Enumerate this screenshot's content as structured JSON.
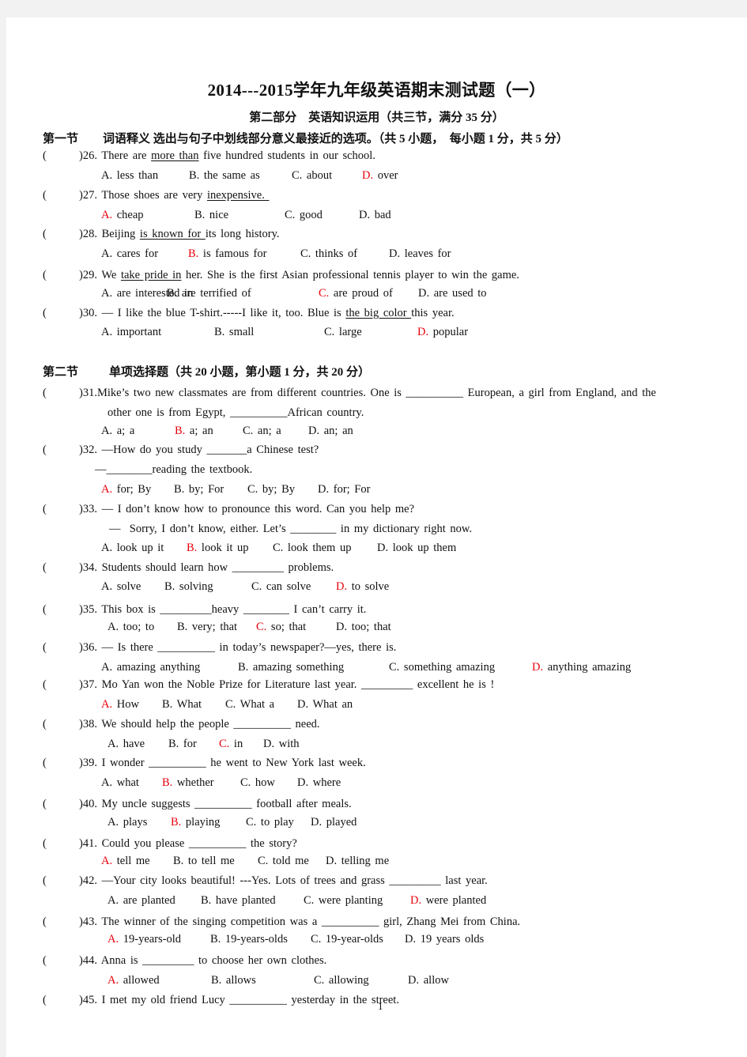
{
  "title": "2014---2015学年九年级英语期末测试题（一）",
  "subtitle": "第二部分    英语知识运用（共三节，满分 35 分）",
  "section1": {
    "label": "第一节",
    "heading": "词语释义 选出与句子中划线部分意义最接近的选项。（共 5 小题，  每小题 1 分，共 5 分）",
    "questions": [
      {
        "num": ")26.",
        "pre": "There are ",
        "underlined": "more than",
        "post": " five hundred students in our school.",
        "options": [
          {
            "letter": "A.",
            "text": " less than",
            "correct": false
          },
          {
            "letter": "B.",
            "text": " the same as",
            "correct": false
          },
          {
            "letter": "C.",
            "text": " about",
            "correct": false
          },
          {
            "letter": "D.",
            "text": " over",
            "correct": true
          }
        ]
      },
      {
        "num": ")27.",
        "pre": "Those shoes are very ",
        "underlined": "inexpensive. ",
        "post": "",
        "options": [
          {
            "letter": "A.",
            "text": " cheap",
            "correct": true
          },
          {
            "letter": "B.",
            "text": " nice",
            "correct": false
          },
          {
            "letter": "C.",
            "text": " good",
            "correct": false
          },
          {
            "letter": "D.",
            "text": " bad",
            "correct": false
          }
        ]
      },
      {
        "num": ")28.",
        "pre": "Beijing ",
        "underlined": "is known for ",
        "post": "its long history.",
        "options": [
          {
            "letter": "A.",
            "text": " cares for",
            "correct": false
          },
          {
            "letter": "B.",
            "text": " is famous for",
            "correct": true
          },
          {
            "letter": "C.",
            "text": " thinks of",
            "correct": false
          },
          {
            "letter": "D.",
            "text": " leaves for",
            "correct": false
          }
        ]
      },
      {
        "num": ")29.",
        "pre": "We ",
        "underlined": "take pride in",
        "post": " her. She is the first Asian professional tennis player to win the game.",
        "options": [
          {
            "letter": "A.",
            "text": " are interested in",
            "correct": false
          },
          {
            "letter": "B.",
            "text": " are terrified of",
            "correct": false
          },
          {
            "letter": "C.",
            "text": " are proud of",
            "correct": true
          },
          {
            "letter": "D.",
            "text": " are used to",
            "correct": false
          }
        ]
      },
      {
        "num": ")30.",
        "pre": "— I like the blue T-shirt.-----I like it, too. Blue is ",
        "underlined": "the big color ",
        "post": "this year.",
        "options": [
          {
            "letter": "A.",
            "text": " important",
            "correct": false
          },
          {
            "letter": "B.",
            "text": " small",
            "correct": false
          },
          {
            "letter": "C.",
            "text": " large",
            "correct": false
          },
          {
            "letter": "D.",
            "text": " popular",
            "correct": true
          }
        ]
      }
    ]
  },
  "section2": {
    "label": "第二节",
    "heading": "单项选择题（共 20 小题，第小题 1 分，共 20 分）",
    "questions": [
      {
        "num": ")31.",
        "lines": [
          "Mike’s two new classmates are from different countries. One is __________ European, a girl from England, and the",
          "other one is from Egypt, __________African country."
        ],
        "options": [
          {
            "letter": "A.",
            "text": " a; a",
            "correct": false
          },
          {
            "letter": "B.",
            "text": " a; an",
            "correct": true
          },
          {
            "letter": "C.",
            "text": " an; a",
            "correct": false
          },
          {
            "letter": "D.",
            "text": " an; an",
            "correct": false
          }
        ]
      },
      {
        "num": ")32.",
        "lines": [
          "—How do you study _______a Chinese test?",
          "—________reading the textbook."
        ],
        "options": [
          {
            "letter": "A.",
            "text": " for; By",
            "correct": true
          },
          {
            "letter": "B.",
            "text": " by; For",
            "correct": false
          },
          {
            "letter": "C.",
            "text": " by; By",
            "correct": false
          },
          {
            "letter": "D.",
            "text": " for; For",
            "correct": false
          }
        ]
      },
      {
        "num": ")33.",
        "lines": [
          "— I don’t know how to pronounce this word. Can you help me?",
          "—  Sorry, I don’t know, either. Let’s ________ in my dictionary right now."
        ],
        "options": [
          {
            "letter": "A.",
            "text": " look up it",
            "correct": false
          },
          {
            "letter": "B.",
            "text": " look it up",
            "correct": true
          },
          {
            "letter": "C.",
            "text": " look them up",
            "correct": false
          },
          {
            "letter": "D.",
            "text": " look up them",
            "correct": false
          }
        ]
      },
      {
        "num": ")34.",
        "lines": [
          "Students should learn how _________ problems."
        ],
        "options": [
          {
            "letter": "A.",
            "text": " solve",
            "correct": false
          },
          {
            "letter": "B.",
            "text": " solving",
            "correct": false
          },
          {
            "letter": "C.",
            "text": " can solve",
            "correct": false
          },
          {
            "letter": "D.",
            "text": " to solve",
            "correct": true
          }
        ]
      },
      {
        "num": ")35.",
        "lines": [
          "This box is _________heavy ________ I can’t carry it."
        ],
        "options": [
          {
            "letter": "A.",
            "text": " too; to",
            "correct": false
          },
          {
            "letter": "B.",
            "text": " very; that",
            "correct": false
          },
          {
            "letter": "C.",
            "text": " so; that",
            "correct": true
          },
          {
            "letter": "D.",
            "text": " too; that",
            "correct": false
          }
        ]
      },
      {
        "num": ")36.",
        "lines": [
          "— Is there __________ in today’s newspaper?—yes, there is."
        ],
        "options": [
          {
            "letter": "A.",
            "text": " amazing anything",
            "correct": false
          },
          {
            "letter": "B.",
            "text": " amazing something",
            "correct": false
          },
          {
            "letter": "C.",
            "text": " something amazing",
            "correct": false
          },
          {
            "letter": "D.",
            "text": " anything amazing",
            "correct": true
          }
        ]
      },
      {
        "num": ")37.",
        "lines": [
          "Mo Yan won the Noble Prize for Literature last year. _________ excellent he is !"
        ],
        "options": [
          {
            "letter": "A.",
            "text": " How",
            "correct": true
          },
          {
            "letter": "B.",
            "text": " What",
            "correct": false
          },
          {
            "letter": "C.",
            "text": " What a",
            "correct": false
          },
          {
            "letter": "D.",
            "text": " What an",
            "correct": false
          }
        ]
      },
      {
        "num": ")38.",
        "lines": [
          "We should help the people __________ need."
        ],
        "options": [
          {
            "letter": "A.",
            "text": " have",
            "correct": false
          },
          {
            "letter": "B.",
            "text": " for",
            "correct": false
          },
          {
            "letter": "C.",
            "text": " in",
            "correct": true
          },
          {
            "letter": "D.",
            "text": " with",
            "correct": false
          }
        ]
      },
      {
        "num": ")39.",
        "lines": [
          "I wonder __________ he went to New York last week."
        ],
        "options": [
          {
            "letter": "A.",
            "text": " what",
            "correct": false
          },
          {
            "letter": "B.",
            "text": " whether",
            "correct": true
          },
          {
            "letter": "C.",
            "text": " how",
            "correct": false
          },
          {
            "letter": "D.",
            "text": " where",
            "correct": false
          }
        ]
      },
      {
        "num": ")40.",
        "lines": [
          "My uncle suggests __________ football after meals."
        ],
        "options": [
          {
            "letter": "A.",
            "text": " plays",
            "correct": false
          },
          {
            "letter": "B.",
            "text": " playing",
            "correct": true
          },
          {
            "letter": "C.",
            "text": " to play",
            "correct": false
          },
          {
            "letter": "D.",
            "text": " played",
            "correct": false
          }
        ]
      },
      {
        "num": ")41.",
        "lines": [
          "Could you please __________ the story?"
        ],
        "options": [
          {
            "letter": "A.",
            "text": " tell me",
            "correct": true
          },
          {
            "letter": "B.",
            "text": " to tell me",
            "correct": false
          },
          {
            "letter": "C.",
            "text": " told me",
            "correct": false
          },
          {
            "letter": "D.",
            "text": " telling me",
            "correct": false
          }
        ]
      },
      {
        "num": ")42.",
        "lines": [
          "—Your city looks beautiful! ---Yes. Lots of trees and grass _________ last year."
        ],
        "options": [
          {
            "letter": "A.",
            "text": " are planted",
            "correct": false
          },
          {
            "letter": "B.",
            "text": " have planted",
            "correct": false
          },
          {
            "letter": "C.",
            "text": " were planting",
            "correct": false
          },
          {
            "letter": "D.",
            "text": " were planted",
            "correct": true
          }
        ]
      },
      {
        "num": ")43.",
        "lines": [
          "The winner of the singing competition was a __________ girl, Zhang Mei from China."
        ],
        "options": [
          {
            "letter": "A.",
            "text": " 19-years-old",
            "correct": true
          },
          {
            "letter": "B.",
            "text": " 19-years-olds",
            "correct": false
          },
          {
            "letter": "C.",
            "text": " 19-year-olds",
            "correct": false
          },
          {
            "letter": "D.",
            "text": " 19 years olds",
            "correct": false
          }
        ]
      },
      {
        "num": ")44.",
        "lines": [
          "Anna is _________ to choose her own clothes."
        ],
        "options": [
          {
            "letter": "A.",
            "text": " allowed",
            "correct": true
          },
          {
            "letter": "B.",
            "text": " allows",
            "correct": false
          },
          {
            "letter": "C.",
            "text": " allowing",
            "correct": false
          },
          {
            "letter": "D.",
            "text": " allow",
            "correct": false
          }
        ]
      },
      {
        "num": ")45.",
        "lines": [
          "I met my old friend Lucy __________ yesterday in the street."
        ],
        "options": []
      }
    ]
  },
  "answer_paren": "(",
  "page_number": "1",
  "colors": {
    "correct_answer": "#e8000b",
    "text": "#111111",
    "page_bg": "#ffffff",
    "desk_bg": "#f2f2f2"
  }
}
